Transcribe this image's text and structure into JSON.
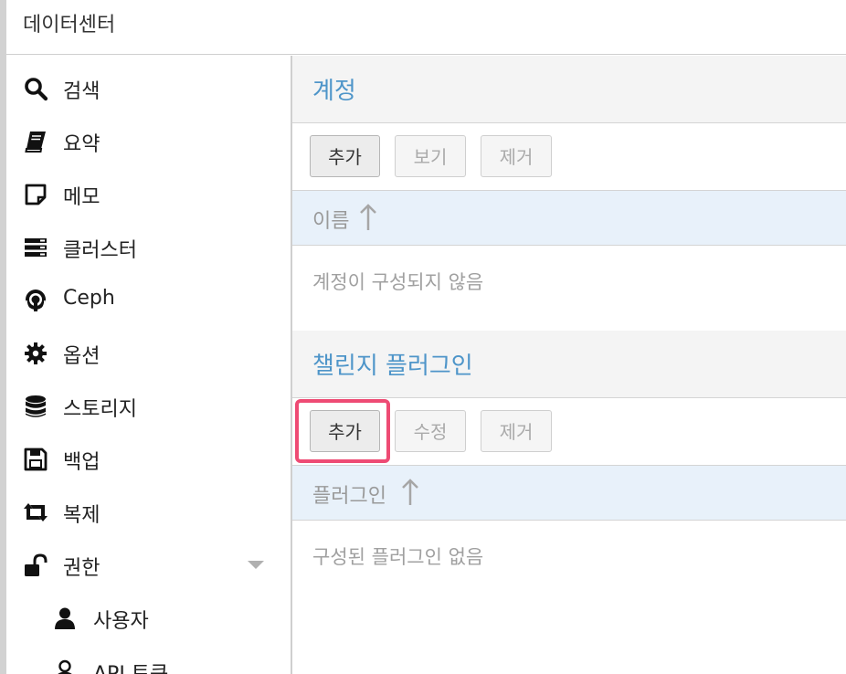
{
  "topbar": {
    "title": "데이터센터"
  },
  "sidebar": {
    "items": [
      {
        "label": "검색",
        "icon": "search-icon"
      },
      {
        "label": "요약",
        "icon": "book-icon"
      },
      {
        "label": "메모",
        "icon": "note-icon"
      },
      {
        "label": "클러스터",
        "icon": "server-icon"
      },
      {
        "label": "Ceph",
        "icon": "ceph-icon"
      },
      {
        "label": "옵션",
        "icon": "gear-icon"
      },
      {
        "label": "스토리지",
        "icon": "database-icon"
      },
      {
        "label": "백업",
        "icon": "floppy-icon"
      },
      {
        "label": "복제",
        "icon": "retweet-icon"
      },
      {
        "label": "권한",
        "icon": "unlock-icon"
      },
      {
        "label": "사용자",
        "icon": "user-icon"
      },
      {
        "label": "API 토큰",
        "icon": "user-outline-icon"
      }
    ]
  },
  "accounts": {
    "title": "계정",
    "buttons": {
      "add": "추가",
      "view": "보기",
      "remove": "제거"
    },
    "column_header": "이름",
    "empty_text": "계정이 구성되지 않음"
  },
  "plugins": {
    "title": "챌린지 플러그인",
    "buttons": {
      "add": "추가",
      "edit": "수정",
      "remove": "제거"
    },
    "column_header": "플러그인",
    "empty_text": "구성된 플러그인 없음"
  },
  "colors": {
    "accent_blue": "#4e95c9",
    "highlight": "#ee4b74",
    "grid_header_bg": "#e8f1fa"
  }
}
